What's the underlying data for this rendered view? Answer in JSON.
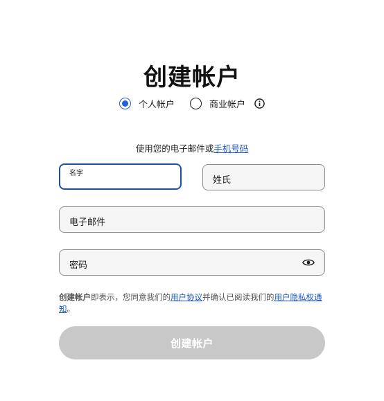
{
  "title": "创建帐户",
  "account_type": {
    "personal_label": "个人帐户",
    "business_label": "商业帐户",
    "selected": "personal"
  },
  "subline": {
    "text": "使用您的电子邮件或",
    "link": "手机号码"
  },
  "fields": {
    "first_name_label": "名字",
    "first_name_value": "",
    "last_name_placeholder": "姓氏",
    "email_placeholder": "电子邮件",
    "password_placeholder": "密码"
  },
  "terms": {
    "bold": "创建帐户",
    "text1": "即表示，您同意我们的",
    "link1": "用户协议",
    "text2": "并确认已阅读我们的",
    "link2": "用户隐私权通知",
    "end": "。"
  },
  "submit_label": "创建帐户",
  "colors": {
    "accent": "#2160d9",
    "focus_border": "#1c4f9c",
    "link": "#1b56c9",
    "button_disabled": "#c8c8c8"
  },
  "icons": {
    "info": "info-icon",
    "password_toggle": "eye-icon"
  }
}
